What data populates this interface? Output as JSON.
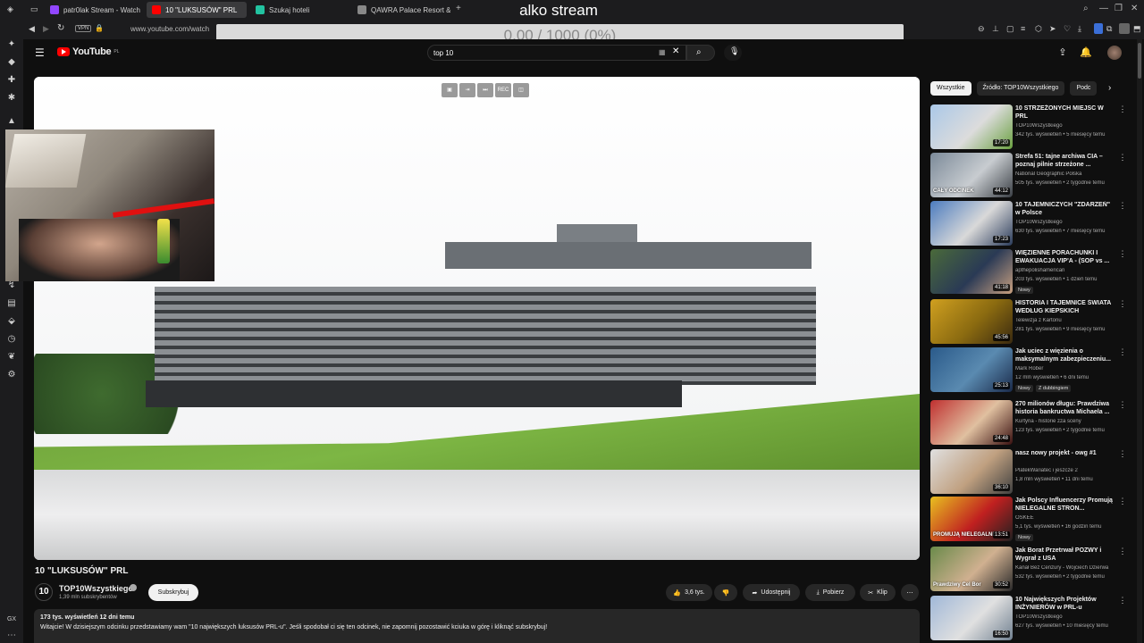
{
  "browser": {
    "tabs": [
      {
        "label": "patr0lak Stream - Watch",
        "color": "#9146ff",
        "active": false
      },
      {
        "label": "10 \"LUKSUSÓW\" PRL",
        "color": "#ff0000",
        "active": true
      },
      {
        "label": "Szukaj hoteli",
        "color": "#22c3a0",
        "active": false
      },
      {
        "label": "QAWRA Palace Resort &",
        "color": "#888888",
        "active": false
      }
    ],
    "overlay_title": "alko stream",
    "url": "www.youtube.com/watch",
    "vpn_label": "VPN",
    "progress_text": "0.00 / 1000 (0%)"
  },
  "youtube": {
    "logo_text": "YouTube",
    "logo_suffix": "PL",
    "search": {
      "value": "top 10"
    }
  },
  "video": {
    "title": "10 \"LUKSUSÓW\" PRL",
    "channel": "TOP10Wszystkiego",
    "subscribers": "1,39 mln subskrybentów",
    "channel_avatar_text": "10",
    "subscribe_label": "Subskrybuj",
    "likes": "3,6 tys.",
    "share_label": "Udostępnij",
    "download_label": "Pobierz",
    "clip_label": "Klip",
    "description_meta": "173 tys. wyświetleń  12 dni temu",
    "description_text": "Witajcie! W dzisiejszym odcinku przedstawiamy wam \"10 największych luksusów PRL-u\". Jeśli spodobał ci się ten odcinek, nie zapomnij pozostawić kciuka w górę i kliknąć subskrybuj!",
    "player_controls": [
      "▣",
      "⇥",
      "⏭",
      "REC",
      "◫"
    ]
  },
  "chips": [
    "Wszystkie",
    "Źródło: TOP10Wszystkiego",
    "Podc"
  ],
  "recommendations": [
    {
      "title": "10 STRZEŻONYCH MIEJSC W PRL",
      "channel": "TOP10Wszystkiego",
      "meta": "342 tys. wyświetleń • 5 miesięcy temu",
      "duration": "17:20",
      "colors": [
        "#aac8e8",
        "#dcdcdc",
        "#6aa040"
      ]
    },
    {
      "title": "Strefa 51: tajne archiwa CIA – poznaj pilnie strzeżone ...",
      "channel": "National Geographic Polska",
      "meta": "505 tys. wyświetleń • 2 tygodnie temu",
      "duration": "44:12",
      "colors": [
        "#7b8a99",
        "#c8ccd0",
        "#3a3f45"
      ],
      "thumb_text": "CAŁY ODCINEK"
    },
    {
      "title": "10 TAJEMNICZYCH \"ZDARZEŃ\" w Polsce",
      "channel": "TOP10Wszystkiego",
      "meta": "630 tys. wyświetleń • 7 miesięcy temu",
      "duration": "17:23",
      "colors": [
        "#4c7cbf",
        "#d9d9d9",
        "#2a3b5a"
      ]
    },
    {
      "title": "WIĘZIENNE PORACHUNKI I EWAKUACJA VIP'A - (SOP vs ...",
      "channel": "apthepolishamerican",
      "meta": "203 tys. wyświetleń • 1 dzień temu",
      "duration": "41:18",
      "colors": [
        "#4a6a3a",
        "#2a3a55",
        "#c8a080"
      ],
      "badge": "Nowy"
    },
    {
      "title": "HISTORIA I TAJEMNICE ŚWIATA WEDŁUG KIEPSKICH",
      "channel": "Telewizja z Kartonu",
      "meta": "281 tys. wyświetleń • 9 miesięcy temu",
      "duration": "45:56",
      "colors": [
        "#d0a020",
        "#8a6a10",
        "#3a2a10"
      ]
    },
    {
      "title": "Jak uciec z więzienia o maksymalnym zabezpieczeniu...",
      "channel": "Mark Rober",
      "meta": "12 mln wyświetleń • 6 dni temu",
      "duration": "25:13",
      "colors": [
        "#2a5a8a",
        "#5a8ab0",
        "#1a2a4a"
      ],
      "badge": "Nowy",
      "badge2": "Z dubbingiem"
    },
    {
      "title": "270 milionów długu: Prawdziwa historia bankructwa Michaela ...",
      "channel": "Kurtyna - historie zza sceny",
      "meta": "123 tys. wyświetleń • 2 tygodnie temu",
      "duration": "24:48",
      "colors": [
        "#c03030",
        "#e0c0a0",
        "#3a1010"
      ]
    },
    {
      "title": "nasz nowy projekt - owg #1",
      "channel": "PlatekWariatec i jeszcze 2",
      "meta": "1,8 mln wyświetleń • 11 dni temu",
      "duration": "36:10",
      "colors": [
        "#e0e0e0",
        "#c0a080",
        "#404040"
      ]
    },
    {
      "title": "Jak Polscy Influencerzy Promują NIELEGALNE STRON...",
      "channel": "OSKEE",
      "meta": "5,1 tys. wyświetleń • 16 godzin temu",
      "duration": "13:51",
      "colors": [
        "#e8c020",
        "#c02020",
        "#202020"
      ],
      "badge": "Nowy",
      "thumb_text": "PROMUJĄ NIELEGALNE"
    },
    {
      "title": "Jak Borat Przetrwał POZWY i Wygrał z USA",
      "channel": "Kanał Bez Cenzury - Wojciech Dzierwa",
      "meta": "532 tys. wyświetleń • 2 tygodnie temu",
      "duration": "30:52",
      "colors": [
        "#6a8a4a",
        "#d0b090",
        "#2a2a2a"
      ],
      "thumb_text": "Prawdziwy Cel Bor"
    },
    {
      "title": "10 Największych Projektów INŻYNIERÓW w PRL-u",
      "channel": "TOP10Wszystkiego",
      "meta": "627 tys. wyświetleń • 10 miesięcy temu",
      "duration": "16:50",
      "colors": [
        "#a0b8d8",
        "#e0e0e0",
        "#708090"
      ]
    }
  ]
}
